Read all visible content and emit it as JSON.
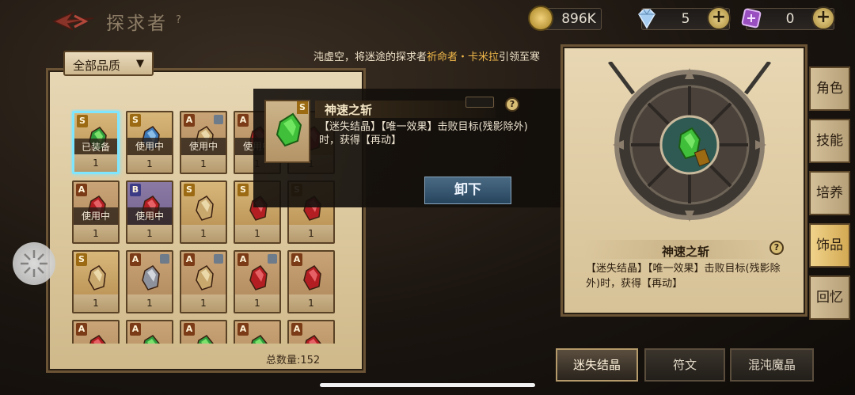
{
  "header": {
    "title": "探求者",
    "help": "?",
    "currencies": [
      {
        "name": "gold-coin",
        "value": "896K",
        "color": "#d8b24a"
      },
      {
        "name": "diamond",
        "value": "5",
        "color": "#9fc6ec"
      },
      {
        "name": "rune-token",
        "value": "0",
        "color": "#b06ad6"
      }
    ],
    "plus": "+"
  },
  "hint": {
    "prefix": "沌虚空，将迷途的探求者",
    "highlight": "祈命者・卡米拉",
    "suffix": "引领至寒"
  },
  "filter": {
    "label": "全部品质"
  },
  "inventory": {
    "total_label": "总数量:152",
    "items": [
      {
        "rarity": "S",
        "frame": "gold",
        "gem": "green",
        "status": "已装备",
        "qty": "1",
        "locked": false,
        "selected": true
      },
      {
        "rarity": "S",
        "frame": "gold",
        "gem": "blue",
        "status": "使用中",
        "qty": "1",
        "locked": false
      },
      {
        "rarity": "A",
        "frame": "red",
        "gem": "tan",
        "status": "使用中",
        "qty": "1",
        "locked": true
      },
      {
        "rarity": "A",
        "frame": "red",
        "gem": "red",
        "status": "使用中",
        "qty": "1",
        "locked": false
      },
      {
        "rarity": "S",
        "frame": "gold",
        "gem": "red",
        "status": "",
        "qty": "1",
        "locked": false
      },
      {
        "rarity": "A",
        "frame": "red",
        "gem": "red",
        "status": "使用中",
        "qty": "1",
        "locked": false
      },
      {
        "rarity": "B",
        "frame": "purple",
        "gem": "red",
        "status": "使用中",
        "qty": "1",
        "locked": false
      },
      {
        "rarity": "S",
        "frame": "gold",
        "gem": "tan",
        "status": "",
        "qty": "1",
        "locked": false
      },
      {
        "rarity": "S",
        "frame": "gold",
        "gem": "red",
        "status": "",
        "qty": "1",
        "locked": false
      },
      {
        "rarity": "S",
        "frame": "gold",
        "gem": "red",
        "status": "",
        "qty": "1",
        "locked": false
      },
      {
        "rarity": "S",
        "frame": "gold",
        "gem": "tan",
        "status": "",
        "qty": "1",
        "locked": false
      },
      {
        "rarity": "A",
        "frame": "red",
        "gem": "silver",
        "status": "",
        "qty": "1",
        "locked": true
      },
      {
        "rarity": "A",
        "frame": "red",
        "gem": "tan",
        "status": "",
        "qty": "1",
        "locked": true
      },
      {
        "rarity": "A",
        "frame": "red",
        "gem": "red",
        "status": "",
        "qty": "1",
        "locked": true
      },
      {
        "rarity": "A",
        "frame": "red",
        "gem": "red",
        "status": "",
        "qty": "1",
        "locked": false
      },
      {
        "rarity": "A",
        "frame": "red",
        "gem": "red",
        "status": "",
        "qty": "",
        "locked": false
      },
      {
        "rarity": "A",
        "frame": "red",
        "gem": "green",
        "status": "",
        "qty": "",
        "locked": false
      },
      {
        "rarity": "A",
        "frame": "red",
        "gem": "green",
        "status": "",
        "qty": "",
        "locked": false
      },
      {
        "rarity": "A",
        "frame": "red",
        "gem": "green",
        "status": "",
        "qty": "",
        "locked": false
      },
      {
        "rarity": "A",
        "frame": "red",
        "gem": "red",
        "status": "",
        "qty": "",
        "locked": false
      }
    ]
  },
  "popup": {
    "rarity": "S",
    "name": "神速之斩",
    "help": "?",
    "description": "【迷失结晶】【唯一效果】击败目标(残影除外)时，获得【再动】",
    "unequip_label": "卸下"
  },
  "detail": {
    "rarity": "S",
    "name": "神速之斩",
    "help": "?",
    "description": "【迷失结晶】【唯一效果】击败目标(残影除外)时，获得【再动】"
  },
  "side_tabs": [
    {
      "label": "角色",
      "active": false
    },
    {
      "label": "技能",
      "active": false
    },
    {
      "label": "培养",
      "active": false
    },
    {
      "label": "饰品",
      "active": true
    },
    {
      "label": "回忆",
      "active": false
    }
  ],
  "bottom_tabs": [
    {
      "label": "迷失结晶",
      "active": true
    },
    {
      "label": "符文",
      "active": false
    },
    {
      "label": "混沌魔晶",
      "active": false
    }
  ]
}
